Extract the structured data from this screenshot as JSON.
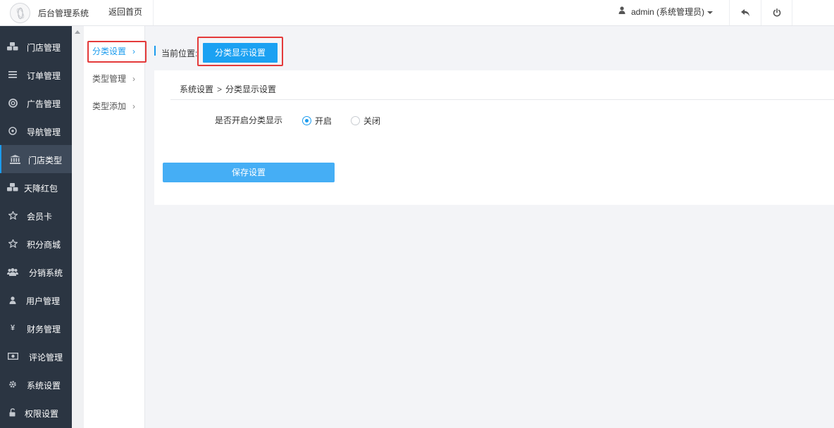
{
  "header": {
    "app_title": "后台管理系统",
    "back_home": "返回首页",
    "user_label": "admin (系统管理员)"
  },
  "sidebar": {
    "items": [
      {
        "label": "门店管理",
        "icon": "cubes-icon"
      },
      {
        "label": "订单管理",
        "icon": "list-icon"
      },
      {
        "label": "广告管理",
        "icon": "lifebuoy-icon"
      },
      {
        "label": "导航管理",
        "icon": "compass-icon"
      },
      {
        "label": "门店类型",
        "icon": "bank-icon",
        "active": true
      },
      {
        "label": "天降红包",
        "icon": "cubes-icon"
      },
      {
        "label": "会员卡",
        "icon": "star-icon"
      },
      {
        "label": "积分商城",
        "icon": "star-icon"
      },
      {
        "label": "分销系统",
        "icon": "users-icon"
      },
      {
        "label": "用户管理",
        "icon": "user-icon"
      },
      {
        "label": "财务管理",
        "icon": "yen-icon"
      },
      {
        "label": "评论管理",
        "icon": "money-icon"
      },
      {
        "label": "系统设置",
        "icon": "gear-icon"
      },
      {
        "label": "权限设置",
        "icon": "unlock-icon"
      }
    ]
  },
  "submenu": {
    "items": [
      {
        "label": "分类设置",
        "active": true
      },
      {
        "label": "类型管理"
      },
      {
        "label": "类型添加"
      }
    ]
  },
  "crumb": {
    "label": "当前位置:",
    "current": "分类显示设置"
  },
  "panel": {
    "path_root": "系统设置",
    "path_sep": ">",
    "path_current": "分类显示设置",
    "field_label": "是否开启分类显示",
    "option_on": "开启",
    "option_off": "关闭",
    "selected": "开启",
    "save_label": "保存设置"
  },
  "colors": {
    "accent": "#1b9bee",
    "sidebar_bg": "#2b3542",
    "highlight": "#e43a3a"
  }
}
